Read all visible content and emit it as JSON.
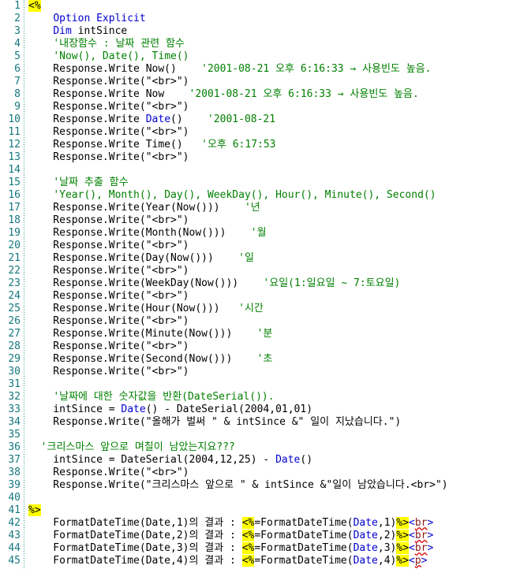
{
  "editor": {
    "title": "ASP VBScript date functions source listing",
    "colors": {
      "background": "#ffffff",
      "line_number": "#14787e",
      "plain_text": "#000000",
      "keyword": "#0000d0",
      "comment": "#008000",
      "asp_delimiter_bg": "#ffff00",
      "html_tag": "#8b1a1a",
      "angle_bracket": "#0000d0",
      "error_squiggle": "#e00000",
      "gutter_rule": "#3a8f95"
    },
    "first_line_number": 1,
    "last_line_number": 45,
    "total_lines": 45
  },
  "lines": [
    {
      "n": "1",
      "tokens": [
        {
          "t": "<%",
          "c": "asp"
        }
      ]
    },
    {
      "n": "2",
      "tokens": [
        {
          "t": "    ",
          "c": "plain"
        },
        {
          "t": "Option Explicit",
          "c": "keyword"
        }
      ]
    },
    {
      "n": "3",
      "tokens": [
        {
          "t": "    ",
          "c": "plain"
        },
        {
          "t": "Dim",
          "c": "keyword"
        },
        {
          "t": " intSince",
          "c": "plain"
        }
      ]
    },
    {
      "n": "4",
      "tokens": [
        {
          "t": "    ",
          "c": "plain"
        },
        {
          "t": "'내장함수 : 날짜 관련 함수",
          "c": "comment"
        }
      ]
    },
    {
      "n": "5",
      "tokens": [
        {
          "t": "    ",
          "c": "plain"
        },
        {
          "t": "'Now(), Date(), Time()",
          "c": "comment"
        }
      ]
    },
    {
      "n": "6",
      "tokens": [
        {
          "t": "    Response.Write Now()",
          "c": "plain"
        },
        {
          "t": "    '2001-08-21 오후 6:16:33 → 사용빈도 높음.",
          "c": "comment"
        }
      ]
    },
    {
      "n": "7",
      "tokens": [
        {
          "t": "    Response.Write(\"<br>\")",
          "c": "plain"
        }
      ]
    },
    {
      "n": "8",
      "tokens": [
        {
          "t": "    Response.Write Now",
          "c": "plain"
        },
        {
          "t": "    '2001-08-21 오후 6:16:33 → 사용빈도 높음.",
          "c": "comment"
        }
      ]
    },
    {
      "n": "9",
      "tokens": [
        {
          "t": "    Response.Write(\"<br>\")",
          "c": "plain"
        }
      ]
    },
    {
      "n": "10",
      "tokens": [
        {
          "t": "    Response.Write ",
          "c": "plain"
        },
        {
          "t": "Date",
          "c": "keyword"
        },
        {
          "t": "()",
          "c": "plain"
        },
        {
          "t": "    '2001-08-21",
          "c": "comment"
        }
      ]
    },
    {
      "n": "11",
      "tokens": [
        {
          "t": "    Response.Write(\"<br>\")",
          "c": "plain"
        }
      ]
    },
    {
      "n": "12",
      "tokens": [
        {
          "t": "    Response.Write Time()",
          "c": "plain"
        },
        {
          "t": "   '오후 6:17:53",
          "c": "comment"
        }
      ]
    },
    {
      "n": "13",
      "tokens": [
        {
          "t": "    Response.Write(\"<br>\")",
          "c": "plain"
        }
      ]
    },
    {
      "n": "14",
      "tokens": [
        {
          "t": "",
          "c": "plain"
        }
      ]
    },
    {
      "n": "15",
      "tokens": [
        {
          "t": "    ",
          "c": "plain"
        },
        {
          "t": "'날짜 추출 함수",
          "c": "comment"
        }
      ]
    },
    {
      "n": "16",
      "tokens": [
        {
          "t": "    ",
          "c": "plain"
        },
        {
          "t": "'Year(), Month(), Day(), WeekDay(), Hour(), Minute(), Second()",
          "c": "comment"
        }
      ]
    },
    {
      "n": "17",
      "tokens": [
        {
          "t": "    Response.Write(Year(Now()))",
          "c": "plain"
        },
        {
          "t": "    '년",
          "c": "comment"
        }
      ]
    },
    {
      "n": "18",
      "tokens": [
        {
          "t": "    Response.Write(\"<br>\")",
          "c": "plain"
        }
      ]
    },
    {
      "n": "19",
      "tokens": [
        {
          "t": "    Response.Write(Month(Now()))",
          "c": "plain"
        },
        {
          "t": "    '월",
          "c": "comment"
        }
      ]
    },
    {
      "n": "20",
      "tokens": [
        {
          "t": "    Response.Write(\"<br>\")",
          "c": "plain"
        }
      ]
    },
    {
      "n": "21",
      "tokens": [
        {
          "t": "    Response.Write(Day(Now()))",
          "c": "plain"
        },
        {
          "t": "    '일",
          "c": "comment"
        }
      ]
    },
    {
      "n": "22",
      "tokens": [
        {
          "t": "    Response.Write(\"<br>\")",
          "c": "plain"
        }
      ]
    },
    {
      "n": "23",
      "tokens": [
        {
          "t": "    Response.Write(WeekDay(Now()))",
          "c": "plain"
        },
        {
          "t": "    '요일(1:일요일 ~ 7:토요일)",
          "c": "comment"
        }
      ]
    },
    {
      "n": "24",
      "tokens": [
        {
          "t": "    Response.Write(\"<br>\")",
          "c": "plain"
        }
      ]
    },
    {
      "n": "25",
      "tokens": [
        {
          "t": "    Response.Write(Hour(Now()))",
          "c": "plain"
        },
        {
          "t": "   '시간",
          "c": "comment"
        }
      ]
    },
    {
      "n": "26",
      "tokens": [
        {
          "t": "    Response.Write(\"<br>\")",
          "c": "plain"
        }
      ]
    },
    {
      "n": "27",
      "tokens": [
        {
          "t": "    Response.Write(Minute(Now()))",
          "c": "plain"
        },
        {
          "t": "    '분",
          "c": "comment"
        }
      ]
    },
    {
      "n": "28",
      "tokens": [
        {
          "t": "    Response.Write(\"<br>\")",
          "c": "plain"
        }
      ]
    },
    {
      "n": "29",
      "tokens": [
        {
          "t": "    Response.Write(Second(Now()))",
          "c": "plain"
        },
        {
          "t": "    '초",
          "c": "comment"
        }
      ]
    },
    {
      "n": "30",
      "tokens": [
        {
          "t": "    Response.Write(\"<br>\")",
          "c": "plain"
        }
      ]
    },
    {
      "n": "31",
      "tokens": [
        {
          "t": "",
          "c": "plain"
        }
      ]
    },
    {
      "n": "32",
      "tokens": [
        {
          "t": "    ",
          "c": "plain"
        },
        {
          "t": "'날짜에 대한 숫자값을 반환(DateSerial()).",
          "c": "comment"
        }
      ]
    },
    {
      "n": "33",
      "tokens": [
        {
          "t": "    intSince = ",
          "c": "plain"
        },
        {
          "t": "Date",
          "c": "keyword"
        },
        {
          "t": "() - DateSerial(2004,01,01)",
          "c": "plain"
        }
      ]
    },
    {
      "n": "34",
      "tokens": [
        {
          "t": "    Response.Write(\"올해가 벌써 \" & intSince &\" 일이 지났습니다.\")",
          "c": "plain"
        }
      ]
    },
    {
      "n": "35",
      "tokens": [
        {
          "t": "",
          "c": "plain"
        }
      ]
    },
    {
      "n": "36",
      "tokens": [
        {
          "t": "  ",
          "c": "plain"
        },
        {
          "t": "'크리스마스 앞으로 며칠이 남았는지요???",
          "c": "comment"
        }
      ]
    },
    {
      "n": "37",
      "tokens": [
        {
          "t": "    intSince = DateSerial(2004,12,25) - ",
          "c": "plain"
        },
        {
          "t": "Date",
          "c": "keyword"
        },
        {
          "t": "()",
          "c": "plain"
        }
      ]
    },
    {
      "n": "38",
      "tokens": [
        {
          "t": "    Response.Write(\"<br>\")",
          "c": "plain"
        }
      ]
    },
    {
      "n": "39",
      "tokens": [
        {
          "t": "    Response.Write(\"크리스마스 앞으로 \" & intSince &\"일이 남았습니다.<br>\")",
          "c": "plain"
        }
      ]
    },
    {
      "n": "40",
      "tokens": [
        {
          "t": "",
          "c": "plain"
        }
      ]
    },
    {
      "n": "41",
      "tokens": [
        {
          "t": "%>",
          "c": "asp"
        }
      ]
    },
    {
      "n": "42",
      "tokens": [
        {
          "t": "    FormatDateTime(Date,1)의 결과 : ",
          "c": "plain"
        },
        {
          "t": "<%",
          "c": "asp"
        },
        {
          "t": "=FormatDateTime(",
          "c": "plain"
        },
        {
          "t": "Date",
          "c": "keyword"
        },
        {
          "t": ",1)",
          "c": "plain"
        },
        {
          "t": "%>",
          "c": "asp"
        },
        {
          "t": "<",
          "c": "bracket"
        },
        {
          "t": "br",
          "c": "tag"
        },
        {
          "t": ">",
          "c": "bracket"
        }
      ]
    },
    {
      "n": "43",
      "tokens": [
        {
          "t": "    FormatDateTime(Date,2)의 결과 : ",
          "c": "plain"
        },
        {
          "t": "<%",
          "c": "asp"
        },
        {
          "t": "=FormatDateTime(",
          "c": "plain"
        },
        {
          "t": "Date",
          "c": "keyword"
        },
        {
          "t": ",2)",
          "c": "plain"
        },
        {
          "t": "%>",
          "c": "asp"
        },
        {
          "t": "<",
          "c": "bracket"
        },
        {
          "t": "br",
          "c": "tag"
        },
        {
          "t": ">",
          "c": "bracket"
        }
      ]
    },
    {
      "n": "44",
      "tokens": [
        {
          "t": "    FormatDateTime(Date,3)의 결과 : ",
          "c": "plain"
        },
        {
          "t": "<%",
          "c": "asp"
        },
        {
          "t": "=FormatDateTime(",
          "c": "plain"
        },
        {
          "t": "Date",
          "c": "keyword"
        },
        {
          "t": ",3)",
          "c": "plain"
        },
        {
          "t": "%>",
          "c": "asp"
        },
        {
          "t": "<",
          "c": "bracket"
        },
        {
          "t": "br",
          "c": "tag"
        },
        {
          "t": ">",
          "c": "bracket"
        }
      ]
    },
    {
      "n": "45",
      "tokens": [
        {
          "t": "    FormatDateTime(Date,4)의 결과 : ",
          "c": "plain"
        },
        {
          "t": "<%",
          "c": "asp"
        },
        {
          "t": "=FormatDateTime(",
          "c": "plain"
        },
        {
          "t": "Date",
          "c": "keyword"
        },
        {
          "t": ",4)",
          "c": "plain"
        },
        {
          "t": "%>",
          "c": "asp"
        },
        {
          "t": "<",
          "c": "bracket"
        },
        {
          "t": "p",
          "c": "tag"
        },
        {
          "t": ">",
          "c": "bracket"
        }
      ]
    }
  ]
}
